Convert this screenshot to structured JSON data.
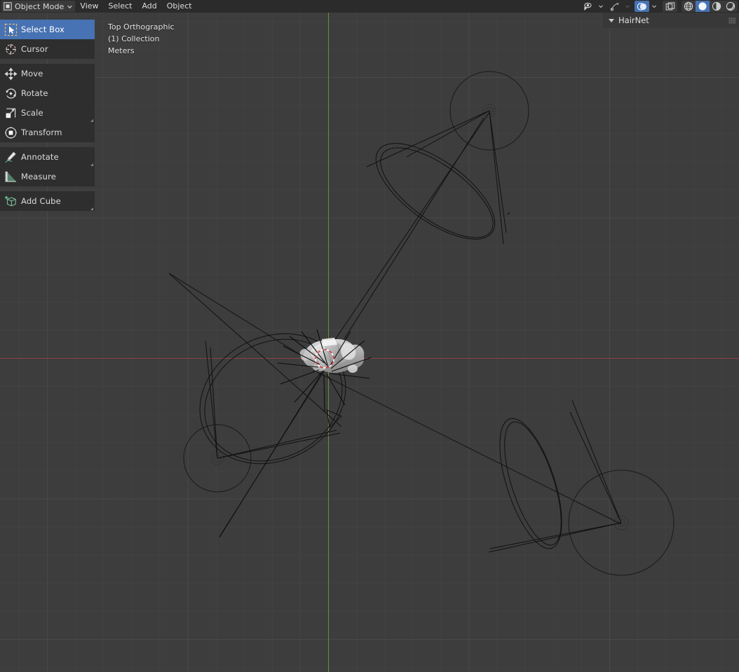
{
  "app": {
    "name": "Blender",
    "theme_bg": "#3d3d3d",
    "accent": "#4772b3"
  },
  "header": {
    "mode": {
      "label": "Object Mode",
      "icon": "object-mode-icon",
      "chevron": "chevron-down-icon"
    },
    "menus": [
      {
        "label": "View",
        "name": "menu-view"
      },
      {
        "label": "Select",
        "name": "menu-select"
      },
      {
        "label": "Add",
        "name": "menu-add"
      },
      {
        "label": "Object",
        "name": "menu-object"
      }
    ],
    "right_controls": [
      {
        "name": "visibility-selectability-icon",
        "tooltip": "Object Types Visibility",
        "state": "off"
      },
      {
        "name": "chevron-down-icon",
        "tooltip": "Object Types Visibility Menu",
        "state": "off"
      },
      {
        "name": "gizmo-icon",
        "tooltip": "Show Gizmo",
        "state": "off"
      },
      {
        "name": "chevron-down-icon",
        "tooltip": "Gizmo Menu",
        "state": "dim"
      },
      {
        "name": "overlays-icon",
        "tooltip": "Show Overlays",
        "state": "on"
      },
      {
        "name": "chevron-down-icon",
        "tooltip": "Overlays Menu",
        "state": "off"
      },
      {
        "name": "xray-toggle-icon",
        "tooltip": "Toggle X-Ray",
        "state": "off"
      }
    ],
    "shading_modes": [
      {
        "name": "shading-wireframe-icon",
        "label": "Wireframe",
        "selected": false
      },
      {
        "name": "shading-solid-icon",
        "label": "Solid",
        "selected": true
      },
      {
        "name": "shading-material-icon",
        "label": "Material Preview",
        "selected": false
      },
      {
        "name": "shading-rendered-icon",
        "label": "Rendered",
        "selected": false
      }
    ]
  },
  "toolbar": {
    "groups": [
      {
        "items": [
          {
            "label": "Select Box",
            "name": "tool-select-box",
            "icon": "select-box-icon",
            "active": true,
            "expandable": false
          },
          {
            "label": "Cursor",
            "name": "tool-cursor",
            "icon": "cursor-3d-icon",
            "active": false,
            "expandable": false
          }
        ]
      },
      {
        "items": [
          {
            "label": "Move",
            "name": "tool-move",
            "icon": "move-icon",
            "active": false,
            "expandable": false
          },
          {
            "label": "Rotate",
            "name": "tool-rotate",
            "icon": "rotate-icon",
            "active": false,
            "expandable": false
          },
          {
            "label": "Scale",
            "name": "tool-scale",
            "icon": "scale-icon",
            "active": false,
            "expandable": true
          },
          {
            "label": "Transform",
            "name": "tool-transform",
            "icon": "transform-icon",
            "active": false,
            "expandable": false
          }
        ]
      },
      {
        "items": [
          {
            "label": "Annotate",
            "name": "tool-annotate",
            "icon": "annotate-pencil-icon",
            "active": false,
            "expandable": true
          },
          {
            "label": "Measure",
            "name": "tool-measure",
            "icon": "measure-ruler-icon",
            "active": false,
            "expandable": false
          }
        ]
      },
      {
        "items": [
          {
            "label": "Add Cube",
            "name": "tool-add-cube",
            "icon": "add-cube-icon",
            "active": false,
            "expandable": true
          }
        ]
      }
    ]
  },
  "viewport": {
    "view_name": "Top Orthographic",
    "collection": "(1) Collection",
    "units": "Meters",
    "axis_x_color": "#8c4346",
    "axis_y_color": "#6c8c3e",
    "grid_color": "#4a4a4a"
  },
  "right_panel": {
    "title": "HairNet",
    "collapse_icon": "triangle-down-icon",
    "grip_icon": "grip-dots-icon"
  },
  "scene": {
    "description": "Top orthographic wireframe view with three cone/circle particle emitter guides and one shaded selected mesh at origin",
    "objects": [
      {
        "name": "cone-guide-top-right",
        "type": "cone-wireframe"
      },
      {
        "name": "cone-guide-bottom-right",
        "type": "cone-wireframe"
      },
      {
        "name": "cone-guide-left",
        "type": "cone-wireframe"
      },
      {
        "name": "selected-mesh-center",
        "type": "shaded-mesh",
        "selected": true
      },
      {
        "name": "cursor-3d",
        "type": "3d-cursor"
      }
    ]
  }
}
